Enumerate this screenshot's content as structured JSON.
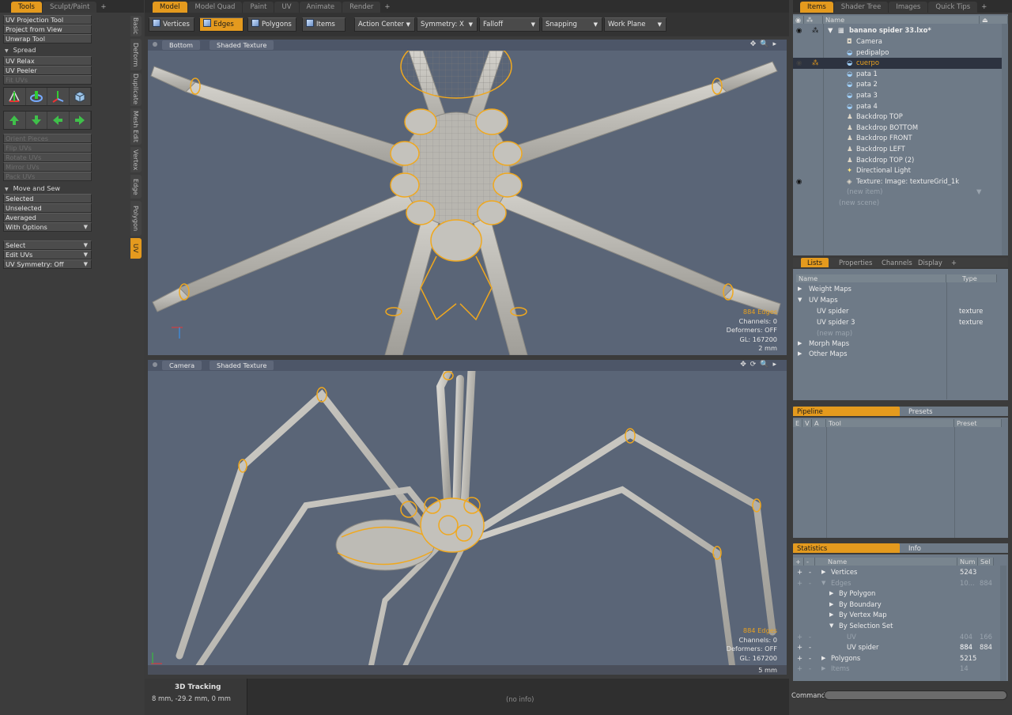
{
  "left_tabs": {
    "tools": "Tools",
    "sculpt": "Sculpt/Paint",
    "plus": "+"
  },
  "top_tabs": [
    "Model",
    "Model Quad",
    "Paint",
    "UV",
    "Animate",
    "Render",
    "+"
  ],
  "items_tabs": [
    "Items",
    "Shader Tree",
    "Images",
    "Quick Tips",
    "+"
  ],
  "tools": {
    "uv_projection_tool": "UV Projection Tool",
    "project_from_view": "Project from View",
    "unwrap_tool": "Unwrap Tool",
    "spread_header": "Spread",
    "uv_relax": "UV Relax",
    "uv_peeler": "UV Peeler",
    "fit_uvs": "Fit UVs",
    "orient_pieces": "Orient Pieces",
    "flip_uvs": "Flip UVs",
    "rotate_uvs": "Rotate UVs",
    "mirror_uvs": "Mirror UVs",
    "pack_uvs": "Pack UVs",
    "move_sew_header": "Move and Sew",
    "selected": "Selected",
    "unselected": "Unselected",
    "averaged": "Averaged",
    "with_options": "With Options",
    "select": "Select",
    "edit_uvs": "Edit UVs",
    "uv_symmetry": "UV Symmetry: Off"
  },
  "vertical_tabs": [
    "Basic",
    "Deform",
    "Duplicate",
    "Mesh Edit",
    "Vertex",
    "Edge",
    "Polygon",
    "UV"
  ],
  "toolbar": {
    "vertices": "Vertices",
    "edges": "Edges",
    "polygons": "Polygons",
    "items": "Items",
    "action_center": "Action Center",
    "symmetry": "Symmetry: X",
    "falloff": "Falloff",
    "snapping": "Snapping",
    "work_plane": "Work Plane"
  },
  "viewport_top": {
    "view": "Bottom",
    "shading": "Shaded Texture",
    "edges": "884 Edges",
    "channels": "Channels: 0",
    "deformers": "Deformers: OFF",
    "gl": "GL: 167200",
    "scale": "2 mm"
  },
  "viewport_bottom": {
    "view": "Camera",
    "shading": "Shaded Texture",
    "edges": "884 Edges",
    "channels": "Channels: 0",
    "deformers": "Deformers: OFF",
    "gl": "GL: 167200",
    "scale": "5 mm"
  },
  "status": {
    "title": "3D Tracking",
    "coords": "8 mm, -29.2 mm, 0 mm",
    "info": "(no info)"
  },
  "items_panel": {
    "name_header": "Name",
    "scene": "banano spider 33.lxo*",
    "items": [
      "Camera",
      "pedipalpo",
      "cuerpo",
      "pata 1",
      "pata 2",
      "pata 3",
      "pata 4",
      "Backdrop TOP",
      "Backdrop BOTTOM",
      "Backdrop FRONT",
      "Backdrop LEFT",
      "Backdrop TOP (2)",
      "Directional Light",
      "Texture: Image: textureGrid_1k"
    ],
    "new_item": "(new item)",
    "new_scene": "(new scene)"
  },
  "lists_tabs": [
    "Lists",
    "Properties",
    "Channels",
    "Display",
    "+"
  ],
  "lists": {
    "name_header": "Name",
    "type_header": "Type",
    "weight_maps": "Weight Maps",
    "uv_maps": "UV Maps",
    "uv_spider": "UV spider",
    "uv_spider_type": "texture",
    "uv_spider3": "UV spider 3",
    "uv_spider3_type": "texture",
    "new_map": "(new map)",
    "morph_maps": "Morph Maps",
    "other_maps": "Other Maps"
  },
  "pipeline_tabs": [
    "Pipeline",
    "Presets"
  ],
  "pipeline_cols": {
    "e": "E",
    "v": "V",
    "a": "A",
    "tool": "Tool",
    "preset": "Preset"
  },
  "stats_tabs": [
    "Statistics",
    "Info"
  ],
  "stats": {
    "plus": "+",
    "minus": "-",
    "name_header": "Name",
    "num_header": "Num",
    "sel_header": "Sel",
    "rows": [
      {
        "name": "Vertices",
        "num": "5243",
        "sel": ""
      },
      {
        "name": "Edges",
        "num": "10...",
        "sel": "884"
      },
      {
        "name": "By Polygon",
        "num": "",
        "sel": ""
      },
      {
        "name": "By Boundary",
        "num": "",
        "sel": ""
      },
      {
        "name": "By Vertex Map",
        "num": "",
        "sel": ""
      },
      {
        "name": "By Selection Set",
        "num": "",
        "sel": ""
      },
      {
        "name": "UV",
        "num": "404",
        "sel": "166"
      },
      {
        "name": "UV spider",
        "num": "884",
        "sel": "884"
      },
      {
        "name": "Polygons",
        "num": "5215",
        "sel": ""
      },
      {
        "name": "Items",
        "num": "14",
        "sel": ""
      }
    ]
  },
  "command_label": "Command",
  "colors": {
    "accent": "#e49a1e",
    "viewport": "#5a6577",
    "panel": "#6e7a87",
    "selection_edge": "#f0a81e"
  }
}
